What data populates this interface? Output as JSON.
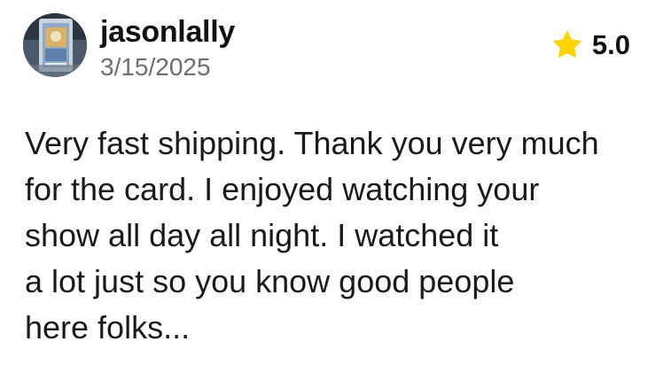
{
  "review": {
    "author": {
      "username": "jasonlally",
      "avatar_icon": "trading-card-avatar"
    },
    "date": "3/15/2025",
    "rating": {
      "value": "5.0",
      "icon": "star-icon",
      "star_color": "#FFD400"
    },
    "text_lines": [
      "Very fast shipping. Thank you very much",
      "for the card. I enjoyed watching your",
      "show all day all night. I watched it",
      "a lot just so you know good people",
      "here folks..."
    ]
  }
}
